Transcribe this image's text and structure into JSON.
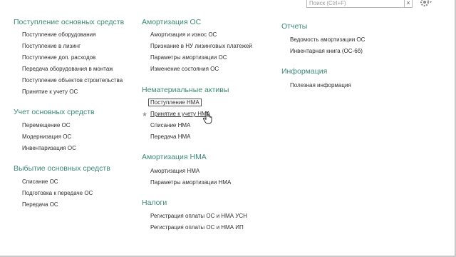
{
  "search": {
    "placeholder": "Поиск (Ctrl+F)",
    "clear_glyph": "×"
  },
  "icons": {
    "settings": "gear-icon",
    "favorite": "star-icon",
    "cursor": "hand-pointer-icon"
  },
  "colors": {
    "group_title": "#3c8a75",
    "item_text": "#2e2e2e"
  },
  "columns": [
    {
      "groups": [
        {
          "title": "Поступление основных средств",
          "items": [
            "Поступление оборудования",
            "Поступление в лизинг",
            "Поступление доп. расходов",
            "Передача оборудования в монтаж",
            "Поступление объектов строительства",
            "Принятие к учету ОС"
          ]
        },
        {
          "title": "Учет основных средств",
          "items": [
            "Перемещение ОС",
            "Модернизация ОС",
            "Инвентаризация ОС"
          ]
        },
        {
          "title": "Выбытие основных средств",
          "items": [
            "Списание ОС",
            "Подготовка к передаче ОС",
            "Передача ОС"
          ]
        }
      ]
    },
    {
      "groups": [
        {
          "title": "Амортизация ОС",
          "items": [
            "Амортизация и износ ОС",
            "Признание в НУ лизинговых платежей",
            "Параметры амортизации ОС",
            "Изменение состояния ОС"
          ]
        },
        {
          "title": "Нематериальные активы",
          "items": [
            "Поступление НМА",
            "Принятие к учету НМА",
            "Списание НМА",
            "Передача НМА"
          ]
        },
        {
          "title": "Амортизация НМА",
          "items": [
            "Амортизация НМА",
            "Параметры амортизации НМА"
          ]
        },
        {
          "title": "Налоги",
          "items": [
            "Регистрация оплаты ОС и НМА УСН",
            "Регистрация оплаты ОС и НМА ИП"
          ]
        }
      ]
    },
    {
      "groups": [
        {
          "title": "Отчеты",
          "items": [
            "Ведомость амортизации ОС",
            "Инвентарная книга (ОС-6б)"
          ]
        },
        {
          "title": "Информация",
          "items": [
            "Полезная информация"
          ]
        }
      ]
    }
  ]
}
